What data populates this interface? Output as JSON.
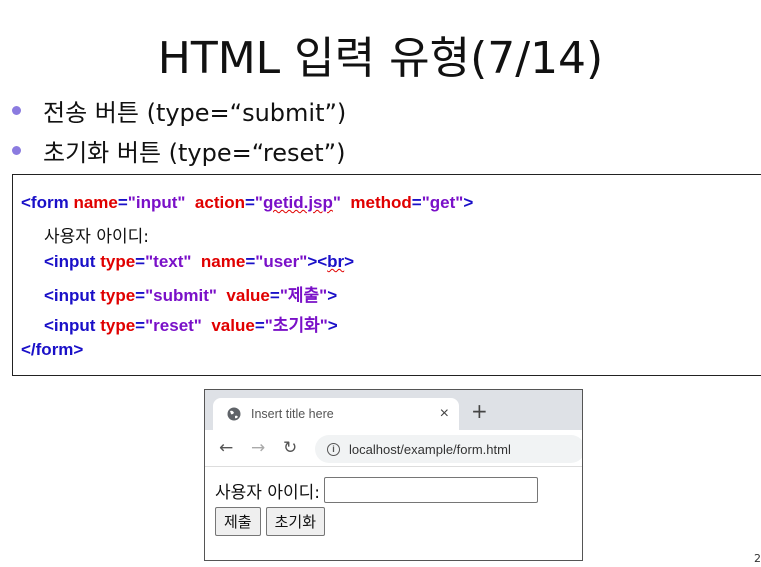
{
  "slide": {
    "title": "HTML 입력 유형(7/14)",
    "bullets": [
      "전송 버튼 (type=“submit”)",
      "초기화 버튼 (type=“reset”)"
    ],
    "page_number": "2"
  },
  "code": {
    "line1": {
      "open": "<form ",
      "a1": "name",
      "eq1": "=",
      "v1": "\"input\"",
      "a2": "action",
      "eq2": "=",
      "v2q1": "\"",
      "v2": "getid.jsp",
      "v2q2": "\"",
      "a3": "method",
      "eq3": "=",
      "v3": "\"get\"",
      "close": ">"
    },
    "line2": "사용자 아이디:",
    "line3": {
      "open": "<input ",
      "a1": "type",
      "eq1": "=",
      "v1": "\"text\"",
      "a2": "name",
      "eq2": "=",
      "v2": "\"user\"",
      "close": "><",
      "br": "br",
      "end": ">"
    },
    "line4": {
      "open": "<input ",
      "a1": "type",
      "eq1": "=",
      "v1": "\"submit\"",
      "a2": "value",
      "eq2": "=",
      "v2": "\"제출\"",
      "close": ">"
    },
    "line5": {
      "open": "<input ",
      "a1": "type",
      "eq1": "=",
      "v1": "\"reset\"",
      "a2": "value",
      "eq2": "=",
      "v2": "\"초기화\"",
      "close": ">"
    },
    "line6": "</form>"
  },
  "browser": {
    "tab_title": "Insert title here",
    "tab_close": "×",
    "new_tab": "+",
    "back": "←",
    "forward": "→",
    "reload": "↻",
    "info": "i",
    "url": "localhost/example/form.html",
    "form_label": "사용자 아이디:",
    "text_value": "",
    "submit_label": "제출",
    "reset_label": "초기화"
  },
  "colors": {
    "tag": "#1a10c8",
    "attr": "#e00000",
    "value": "#7a10c8",
    "bullet": "#8b7be0"
  }
}
